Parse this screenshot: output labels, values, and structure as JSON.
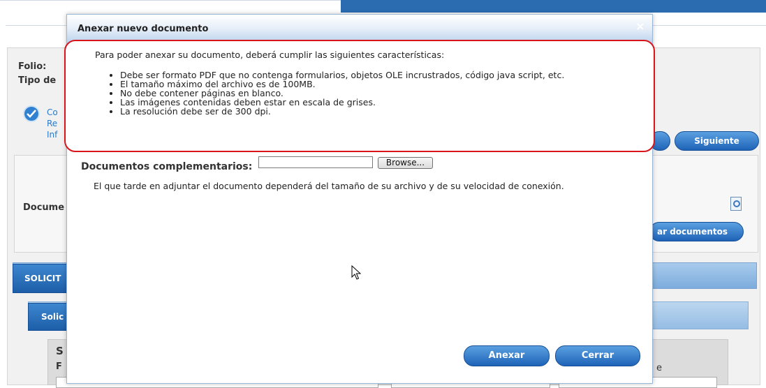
{
  "background": {
    "folio_label": "Folio:",
    "tipo_label": "Tipo de",
    "link_lines": [
      "Co",
      "Re",
      "Inf"
    ],
    "siguiente_label": "Siguiente",
    "documentos_label": "Docume",
    "adjuntar_label": "ar documentos",
    "solicitud_tab": "SOLICIT",
    "solic_subtab": "Solic",
    "section_letter": "S",
    "field_letter": "F",
    "right_letter": "e"
  },
  "modal": {
    "title": "Anexar nuevo documento",
    "close_glyph": "×",
    "intro": "Para poder anexar su documento, deberá cumplir las siguientes características:",
    "requirements": [
      "Debe ser formato PDF que no contenga formularios, objetos OLE incrustrados, código java script, etc.",
      "El tamaño máximo del archivo es de 100MB.",
      "No debe contener páginas en blanco.",
      "Las imágenes contenidas deben estar en escala de grises.",
      "La resolución debe ser de 300 dpi."
    ],
    "complementarios_label": "Documentos complementarios:",
    "file_value": "",
    "browse_label": "Browse...",
    "note": "El que tarde en adjuntar el documento dependerá del tamaño de su archivo y de su velocidad de conexión.",
    "anexar_label": "Anexar",
    "cerrar_label": "Cerrar"
  },
  "icons": {
    "check": "check-circle-icon",
    "close": "close-icon",
    "cursor": "mouse-pointer-icon",
    "doc": "document-search-icon"
  },
  "colors": {
    "accent": "#1f63b8",
    "highlight_border": "#d9141b"
  }
}
